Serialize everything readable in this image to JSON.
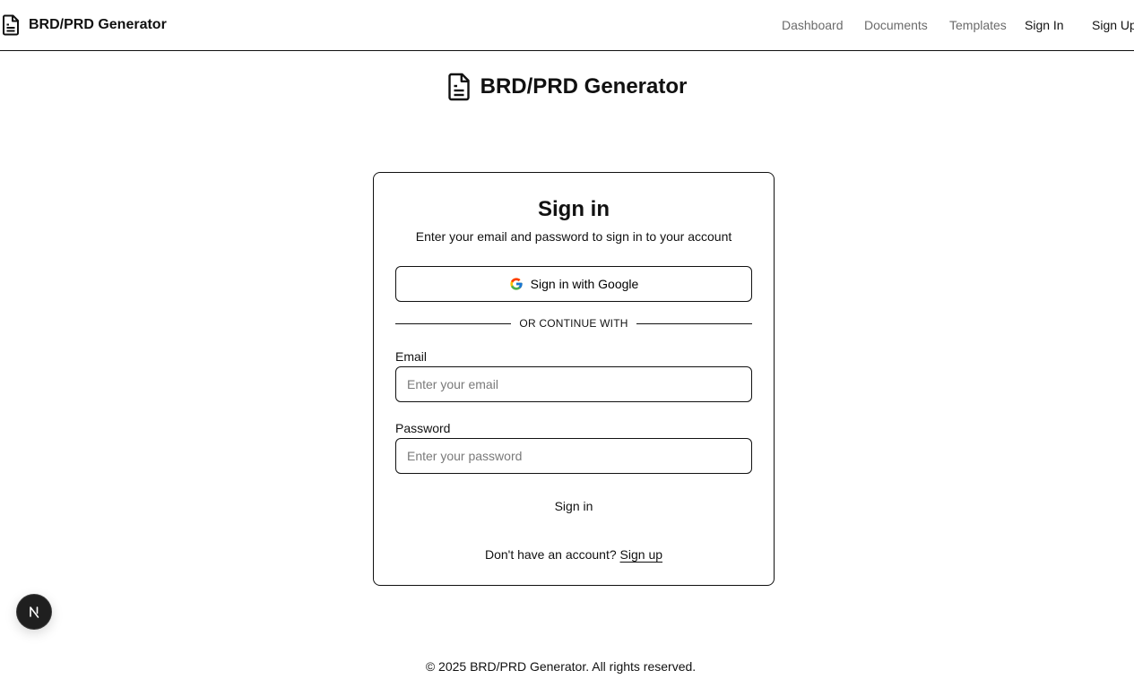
{
  "nav": {
    "brand": "BRD/PRD Generator",
    "brand_icon": "document-icon",
    "links": {
      "dashboard": "Dashboard",
      "documents": "Documents",
      "templates": "Templates",
      "sign_in": "Sign In",
      "sign_up": "Sign Up"
    }
  },
  "header": {
    "title": "BRD/PRD Generator",
    "icon": "document-icon"
  },
  "signin_card": {
    "title": "Sign in",
    "description": "Enter your email and password to sign in to your account",
    "google_button": "Sign in with Google",
    "google_icon": "google-icon",
    "divider": "OR CONTINUE WITH",
    "email": {
      "label": "Email",
      "placeholder": "Enter your email",
      "value": ""
    },
    "password": {
      "label": "Password",
      "placeholder": "Enter your password",
      "value": ""
    },
    "submit_button": "Sign in",
    "signup_prompt": "Don't have an account?",
    "signup_link": "Sign up"
  },
  "dev_badge": {
    "letter": "N",
    "icon": "nextjs-icon"
  },
  "footer": {
    "text": "© 2025 BRD/PRD Generator. All rights reserved."
  },
  "colors": {
    "text": "#111111",
    "muted": "#6b6b6b",
    "placeholder": "#7a7a7a",
    "background": "#ffffff",
    "badge": "#1f1f1f"
  }
}
